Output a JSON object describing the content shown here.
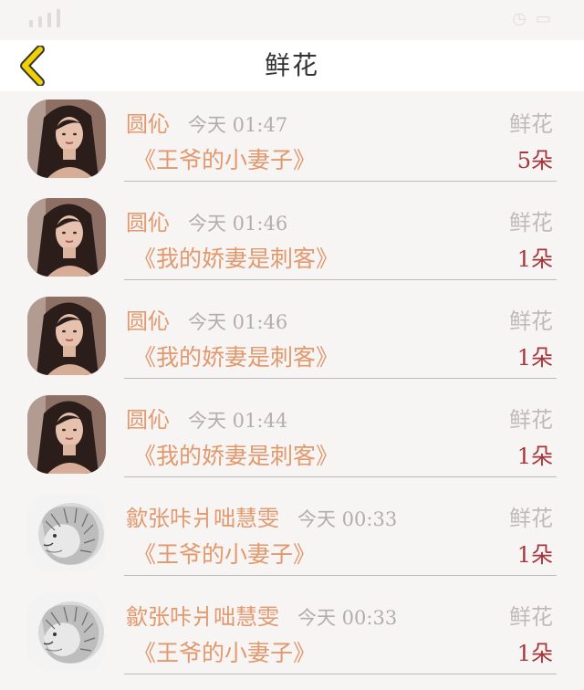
{
  "header": {
    "title": "鲜花",
    "back_icon": "chevron-left-icon",
    "accent_color": "#f0d000"
  },
  "colors": {
    "name": "#e1996d",
    "book": "#e1996d",
    "count": "#a5363c",
    "muted": "#b3aeae"
  },
  "items": [
    {
      "avatar": "woman-portrait",
      "name": "圆伈",
      "time": "今天 01:47",
      "book": "《王爷的小妻子》",
      "gift": "鲜花",
      "count": "5朵"
    },
    {
      "avatar": "woman-portrait",
      "name": "圆伈",
      "time": "今天 01:46",
      "book": "《我的娇妻是刺客》",
      "gift": "鲜花",
      "count": "1朵"
    },
    {
      "avatar": "woman-portrait",
      "name": "圆伈",
      "time": "今天 01:46",
      "book": "《我的娇妻是刺客》",
      "gift": "鲜花",
      "count": "1朵"
    },
    {
      "avatar": "woman-portrait",
      "name": "圆伈",
      "time": "今天 01:44",
      "book": "《我的娇妻是刺客》",
      "gift": "鲜花",
      "count": "1朵"
    },
    {
      "avatar": "lion-sketch",
      "name": "歙张咔爿咄慧雯",
      "time": "今天 00:33",
      "book": "《王爷的小妻子》",
      "gift": "鲜花",
      "count": "1朵"
    },
    {
      "avatar": "lion-sketch",
      "name": "歙张咔爿咄慧雯",
      "time": "今天 00:33",
      "book": "《王爷的小妻子》",
      "gift": "鲜花",
      "count": "1朵"
    }
  ]
}
